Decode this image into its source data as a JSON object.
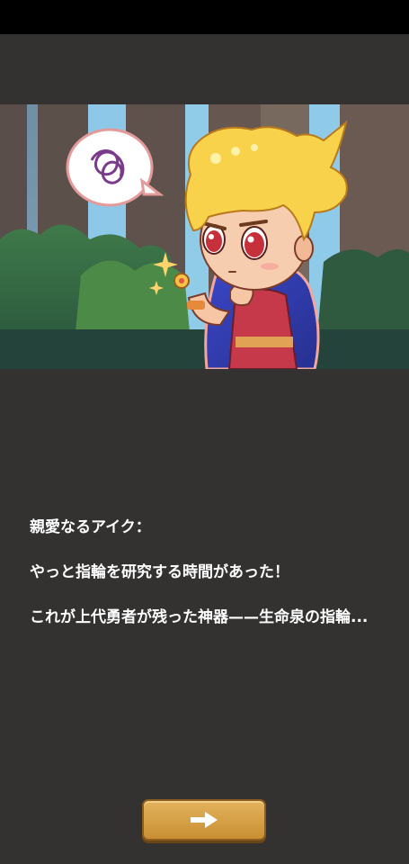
{
  "letter": {
    "greeting": "親愛なるアイク：",
    "line1": "やっと指輪を研究する時間があった！",
    "line2": "これが上代勇者が残った神器——生命泉の指輪..."
  },
  "next_button": {
    "icon": "arrow-right-icon"
  },
  "colors": {
    "background": "#333230",
    "button": "#d9a44b",
    "text": "#ffffff"
  }
}
